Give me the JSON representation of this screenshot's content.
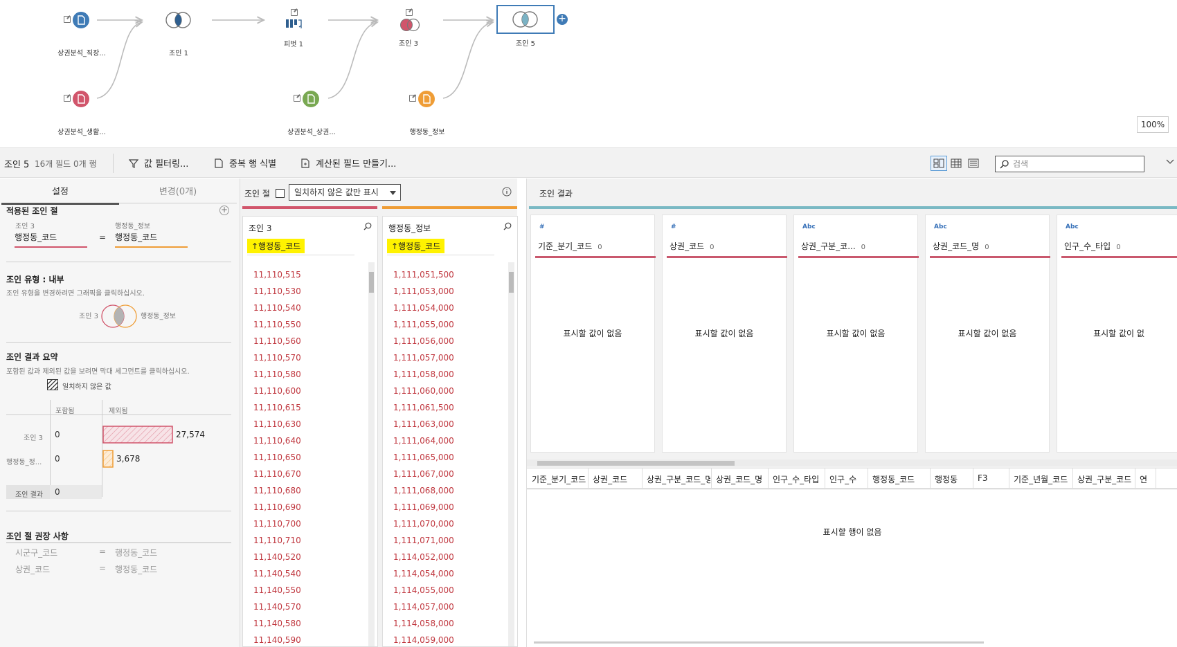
{
  "flow": {
    "nodes": [
      {
        "id": "src1",
        "label": "상권분석_직장..."
      },
      {
        "id": "src2",
        "label": "상권분석_생활..."
      },
      {
        "id": "join1",
        "label": "조인 1"
      },
      {
        "id": "pivot1",
        "label": "피벗 1"
      },
      {
        "id": "src3",
        "label": "상권분석_상권..."
      },
      {
        "id": "join3",
        "label": "조인 3"
      },
      {
        "id": "src4",
        "label": "행정동_정보"
      },
      {
        "id": "join5",
        "label": "조인 5"
      }
    ],
    "zoom": "100%",
    "colors": {
      "blue": "#3f7bb6",
      "pink": "#d1556b",
      "green": "#79a852",
      "orange": "#ef9d36",
      "link": "#bbbbbb"
    }
  },
  "toolbar": {
    "step_name": "조인 5",
    "meta": "16개 필드 0개 행",
    "filter_label": "값 필터링...",
    "dedupe_label": "중복 행 식별",
    "calc_label": "계산된 필드 만들기...",
    "search_placeholder": "검색"
  },
  "settings": {
    "tab_settings": "설정",
    "tab_changes": "변경(0개)",
    "applied_clause_title": "적용된 조인 절",
    "left_source": "조인 3",
    "right_source": "행정동_정보",
    "left_field": "행정동_코드",
    "equals": "=",
    "right_field": "행정동_코드",
    "join_type_title": "조인 유형 : 내부",
    "join_type_help": "조인 유형을 변경하려면 그래픽을 클릭하십시오.",
    "venn_left": "조인 3",
    "venn_right": "행정동_정보",
    "summary_title": "조인 결과 요약",
    "summary_help": "포함된 값과 제외된 값을 보려면 막대 세그먼트를 클릭하십시오.",
    "unmatched_legend": "일치하지 않은 값",
    "col_included": "포함됨",
    "col_excluded": "제외됨",
    "rows": [
      {
        "name": "조인 3",
        "included": "0",
        "excluded": "27,574",
        "excluded_value": 27574,
        "color": "#d1556b"
      },
      {
        "name": "행정동_정...",
        "included": "0",
        "excluded": "3,678",
        "excluded_value": 3678,
        "color": "#ef9d36"
      }
    ],
    "result_row_name": "조인 결과",
    "result_row_value": "0",
    "recommend_title": "조인 절 권장 사항",
    "recommendations": [
      {
        "left": "시군구_코드",
        "eq": "=",
        "right": "행정동_코드"
      },
      {
        "left": "상권_코드",
        "eq": "=",
        "right": "행정동_코드"
      }
    ]
  },
  "clause": {
    "title": "조인 절",
    "checkbox_label": "일치하지 않은 값만 표시",
    "left_col": {
      "name": "조인 3",
      "field": "↑행정동_코드",
      "values": [
        "11,110,515",
        "11,110,530",
        "11,110,540",
        "11,110,550",
        "11,110,560",
        "11,110,570",
        "11,110,580",
        "11,110,600",
        "11,110,615",
        "11,110,630",
        "11,110,640",
        "11,110,650",
        "11,110,670",
        "11,110,680",
        "11,110,690",
        "11,110,700",
        "11,110,710",
        "11,140,520",
        "11,140,540",
        "11,140,550",
        "11,140,570",
        "11,140,580",
        "11,140,590"
      ]
    },
    "right_col": {
      "name": "행정동_정보",
      "field": "↑행정동_코드",
      "values": [
        "1,111,051,500",
        "1,111,053,000",
        "1,111,054,000",
        "1,111,055,000",
        "1,111,056,000",
        "1,111,057,000",
        "1,111,058,000",
        "1,111,060,000",
        "1,111,061,500",
        "1,111,063,000",
        "1,111,064,000",
        "1,111,065,000",
        "1,111,067,000",
        "1,111,068,000",
        "1,111,069,000",
        "1,111,070,000",
        "1,111,071,000",
        "1,114,052,000",
        "1,114,054,000",
        "1,114,055,000",
        "1,114,057,000",
        "1,114,058,000",
        "1,114,059,000"
      ]
    }
  },
  "results": {
    "title": "조인 결과",
    "profile_cards": [
      {
        "type": "#",
        "name": "기준_분기_코드",
        "count": "0",
        "empty": "표시할 값이 없음"
      },
      {
        "type": "#",
        "name": "상권_코드",
        "count": "0",
        "empty": "표시할 값이 없음"
      },
      {
        "type": "Abc",
        "name": "상권_구분_코...",
        "count": "0",
        "empty": "표시할 값이 없음"
      },
      {
        "type": "Abc",
        "name": "상권_코드_명",
        "count": "0",
        "empty": "표시할 값이 없음"
      },
      {
        "type": "Abc",
        "name": "인구_수_타입",
        "count": "0",
        "empty": "표시할 값이 없"
      }
    ],
    "grid_columns": [
      "기준_분기_코드",
      "상권_코드",
      "상권_구분_코드_명",
      "상권_코드_명",
      "인구_수_타입",
      "인구_수",
      "행정동_코드",
      "행정동",
      "F3",
      "기준_년월_코드",
      "상권_구분_코드",
      "연"
    ],
    "empty_rows": "표시할 행이 없음"
  }
}
